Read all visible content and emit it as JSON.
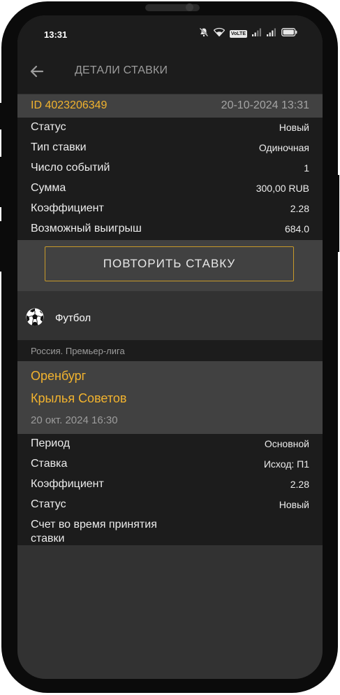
{
  "status_bar": {
    "time": "13:31",
    "volte": "VoLTE"
  },
  "app_bar": {
    "title": "ДЕТАЛИ СТАВКИ"
  },
  "bet": {
    "id": "ID 4023206349",
    "datetime": "20-10-2024 13:31",
    "details": [
      {
        "label": "Статус",
        "value": "Новый"
      },
      {
        "label": "Тип ставки",
        "value": "Одиночная"
      },
      {
        "label": "Число событий",
        "value": "1"
      },
      {
        "label": "Сумма",
        "value": "300,00 RUB"
      },
      {
        "label": "Коэффициент",
        "value": "2.28"
      },
      {
        "label": "Возможный выигрыш",
        "value": "684.0"
      }
    ],
    "repeat_button": "ПОВТОРИТЬ СТАВКУ"
  },
  "event": {
    "sport": "Футбол",
    "league": "Россия. Премьер-лига",
    "team_home": "Оренбург",
    "team_away": "Крылья Советов",
    "date": "20 окт. 2024 16:30",
    "details": [
      {
        "label": "Период",
        "value": "Основной"
      },
      {
        "label": "Ставка",
        "value": "Исход: П1"
      },
      {
        "label": "Коэффициент",
        "value": "2.28"
      },
      {
        "label": "Статус",
        "value": "Новый"
      }
    ],
    "score_label": "Счет во время принятия ставки"
  },
  "colors": {
    "accent": "#f2b32e",
    "button_border": "#c89a2a",
    "dark_bg": "#1c1c1c",
    "mid_bg": "#414141",
    "page_bg": "#323232"
  },
  "icons": {
    "back": "arrow-left-icon",
    "sport": "soccer-ball-icon"
  }
}
